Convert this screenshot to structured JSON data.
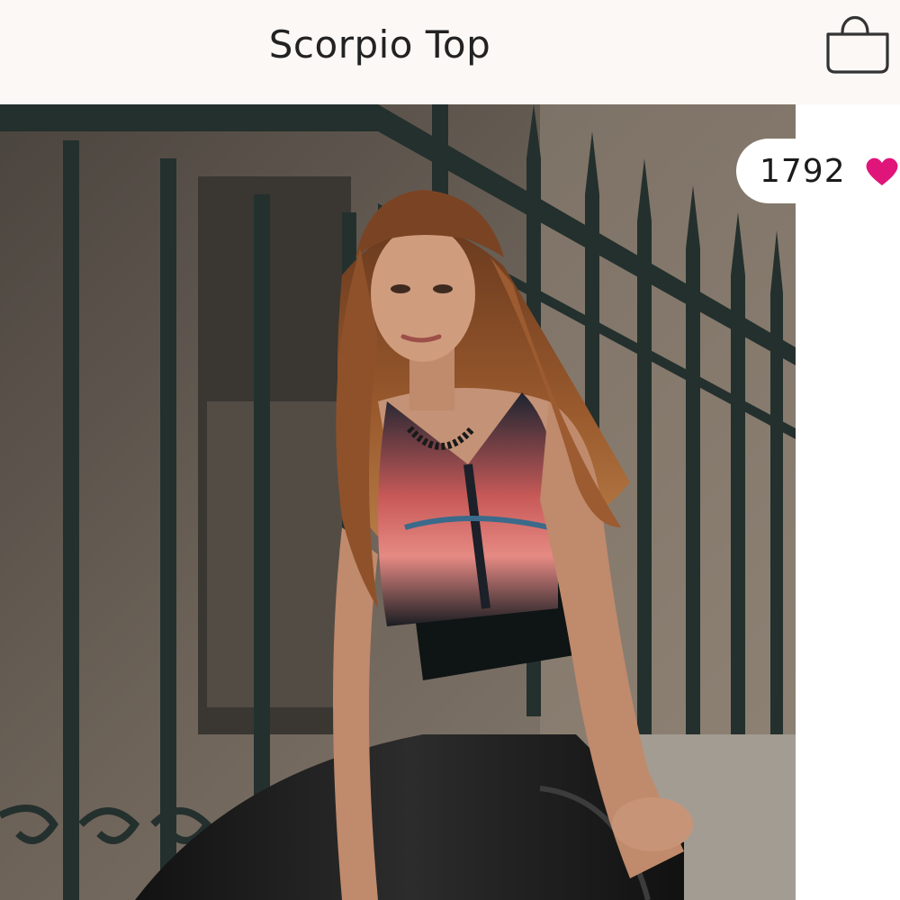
{
  "header": {
    "title": "Scorpio Top",
    "bag_icon": "shopping-bag-icon"
  },
  "product_image": {
    "subject": "product-photo"
  },
  "likes": {
    "count": "1792",
    "icon": "heart-icon",
    "icon_color": "#e0157a"
  }
}
